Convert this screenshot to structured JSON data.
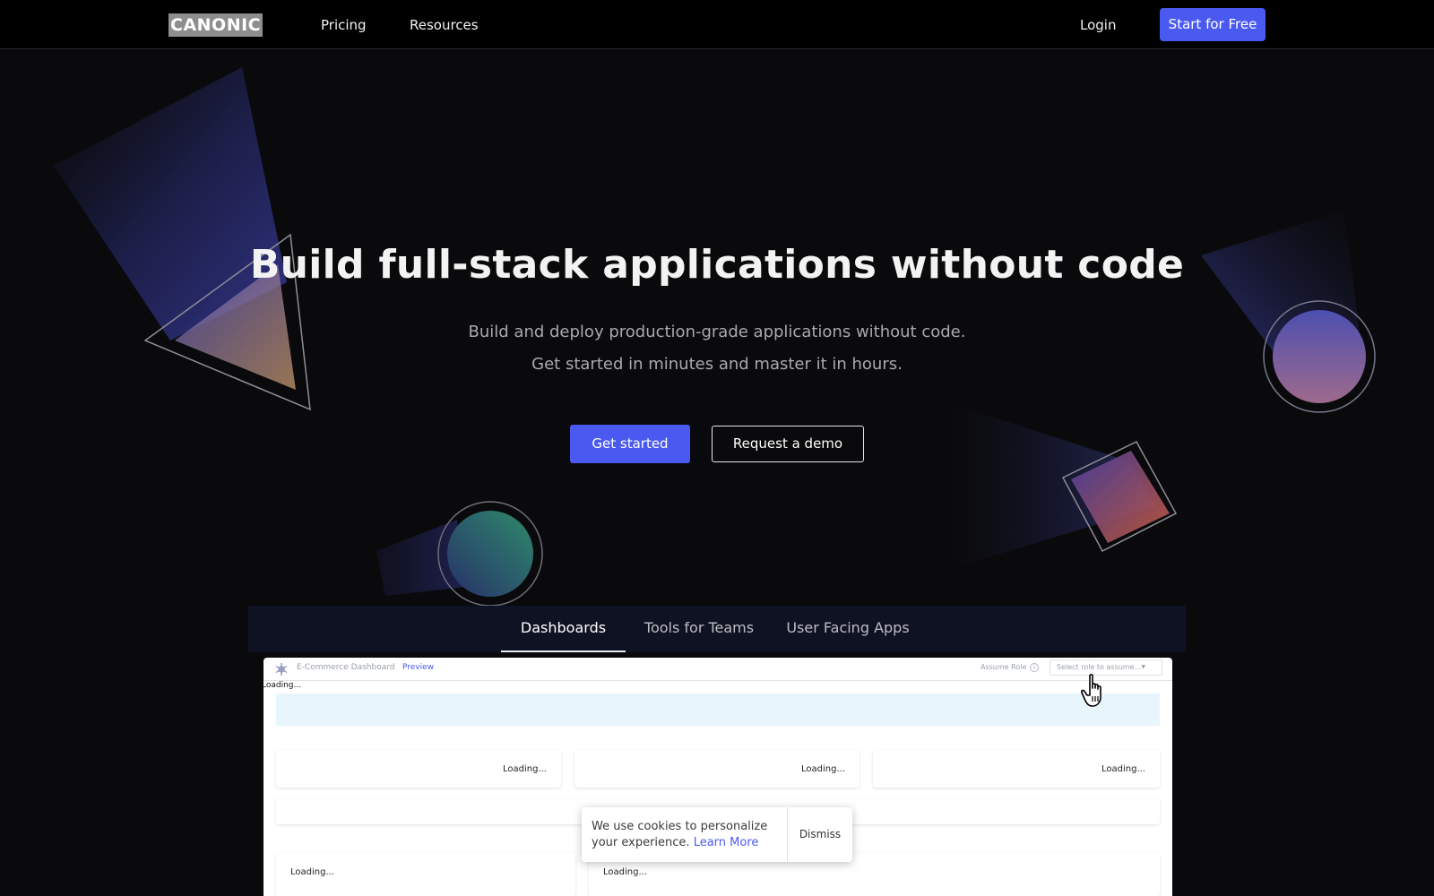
{
  "nav": {
    "logo": "CANONIC",
    "links": [
      {
        "label": "Pricing"
      },
      {
        "label": "Resources"
      }
    ],
    "login": "Login",
    "cta": "Start for Free"
  },
  "hero": {
    "title": "Build full-stack applications without code",
    "subtitle_line1": "Build and deploy production-grade applications without code.",
    "subtitle_line2": "Get started in minutes and master it in hours.",
    "primary_button": "Get started",
    "secondary_button": "Request a demo"
  },
  "tabs": [
    {
      "label": "Dashboards",
      "active": true
    },
    {
      "label": "Tools for Teams",
      "active": false
    },
    {
      "label": "User Facing Apps",
      "active": false
    }
  ],
  "preview": {
    "app_name": "E-Commerce Dashboard",
    "preview_label": "Preview",
    "assume_role_label": "Assume Role",
    "role_select_placeholder": "Select role to assume...",
    "loading_text": "Loading...",
    "cards": [
      {
        "loading": "Loading..."
      },
      {
        "loading": "Loading..."
      },
      {
        "loading": "Loading..."
      },
      {
        "loading": "Loading..."
      },
      {
        "loading": "Loading..."
      }
    ]
  },
  "cookie": {
    "text": "We use cookies to personalize your experience.",
    "link": "Learn More",
    "dismiss": "Dismiss"
  },
  "colors": {
    "accent": "#4a5af0",
    "background": "#0a0a0c",
    "nav_background": "#000000",
    "tab_bar": "#0f1222"
  },
  "icons": {
    "app_logo": "gear-snowflake-icon",
    "info": "info-icon",
    "caret": "chevron-down-icon",
    "cursor": "hand-pointer-icon"
  }
}
